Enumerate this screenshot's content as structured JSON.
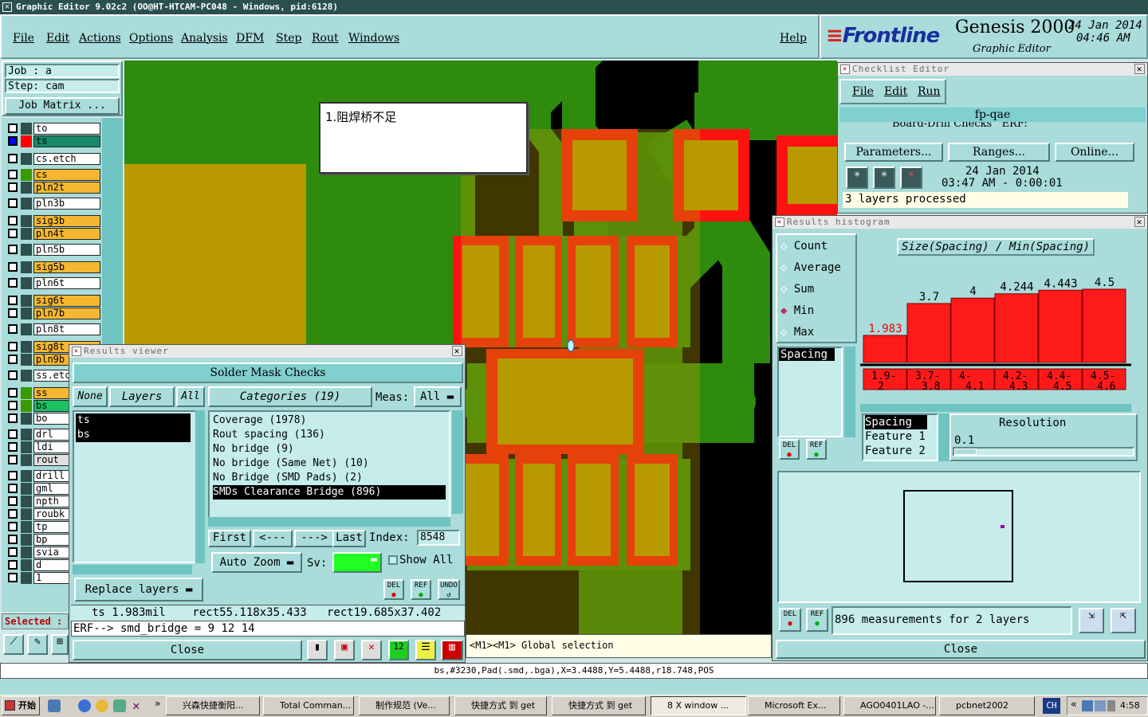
{
  "window_title": "Graphic Editor 9.02c2  (OO@HT-HTCAM-PC048 - Windows, pid:6128)",
  "menu": [
    "File",
    "Edit",
    "Actions",
    "Options",
    "Analysis",
    "DFM",
    "Step",
    "Rout",
    "Windows"
  ],
  "help": "Help",
  "brand": {
    "logo": "Frontline",
    "product": "Genesis 2000",
    "sub": "Graphic Editor",
    "date": "24 Jan 2014",
    "time": "04:46 AM"
  },
  "job": {
    "job": "Job : a",
    "step": "Step: cam",
    "matrix": "Job Matrix ..."
  },
  "layers": [
    "to",
    "ts",
    "cs.etch",
    "cs",
    "pln2t",
    "pln3b",
    "sig3b",
    "pln4t",
    "pln5b",
    "sig5b",
    "pln6t",
    "sig6t",
    "pln7b",
    "pln8t",
    "sig8t",
    "pln9b",
    "ss.etc",
    "ss",
    "bs",
    "bo",
    "drl",
    "ldi",
    "rout",
    "drill",
    "gml",
    "npth",
    "roubk",
    "tp",
    "bp",
    "svia",
    "d",
    "1"
  ],
  "selected_label": "Selected :",
  "annotation": "1.阻焊桥不足",
  "results_viewer": {
    "title": "Results viewer",
    "heading": "Solder Mask Checks",
    "none": "None",
    "layers": "Layers",
    "all": "All",
    "categories": "Categories (19)",
    "meas_label": "Meas:",
    "meas_value": "All",
    "layer_list": [
      "ts",
      "bs"
    ],
    "category_list": [
      "Coverage (1978)",
      "Rout spacing (136)",
      "No bridge (9)",
      "No bridge (Same Net) (10)",
      "No Bridge (SMD Pads) (2)",
      "SMDs Clearance Bridge (896)"
    ],
    "first": "First",
    "prev": "<---",
    "next": "--->",
    "last": "Last",
    "index_label": "Index:",
    "index_value": "8548",
    "auto_zoom": "Auto Zoom",
    "sv": "Sv:",
    "show_all": "Show All",
    "replace": "Replace layers",
    "del": "DEL",
    "ref": "REF",
    "undo": "UNDO",
    "info": "ts 1.983mil    rect55.118x35.433   rect19.685x37.402",
    "erf": "ERF--> smd_bridge = 9 12 14",
    "close": "Close"
  },
  "checklist": {
    "title": "Checklist Editor",
    "menu": [
      "File",
      "Edit",
      "Run"
    ],
    "name": "fp-qae",
    "row": "Board-Drill Checks",
    "erf": "ERF:",
    "params": "Parameters...",
    "ranges": "Ranges...",
    "online": "Online...",
    "date": "24 Jan 2014",
    "time": "03:47 AM - 0:00:01",
    "status": "3 layers processed"
  },
  "histogram": {
    "title": "Results histogram",
    "options": [
      "Count",
      "Average",
      "Sum",
      "Min",
      "Max"
    ],
    "selected_option": "Min",
    "chart_title": "Size(Spacing) / Min(Spacing)",
    "param": "Spacing",
    "res_list": [
      "Spacing",
      "Feature 1",
      "Feature 2"
    ],
    "resolution_label": "Resolution",
    "resolution_value": "0.1",
    "summary": "896 measurements for 2 layers",
    "close": "Close",
    "del": "DEL",
    "ref": "REF"
  },
  "chart_data": {
    "type": "bar",
    "title": "Size(Spacing) / Min(Spacing)",
    "categories": [
      "1.9-2",
      "3.7-3.8",
      "4-4.1",
      "4.2-4.3",
      "4.4-4.5",
      "4.5-4.6"
    ],
    "values": [
      1.983,
      3.7,
      4,
      4.244,
      4.443,
      4.5
    ],
    "value_labels": [
      "1.983",
      "3.7",
      "4",
      "4.244",
      "4.443",
      "4.5"
    ],
    "ylim": [
      0,
      4.5
    ]
  },
  "status_line": "<M1><M1> Global selection",
  "coord_line": "bs,#3230,Pad(.smd,.bga),X=3.4488,Y=5.4488,r18.748,POS",
  "taskbar": {
    "start": "开始",
    "tasks": [
      "兴森快捷衡阳...",
      "Total Comman...",
      "制作规范 (Ve...",
      "快捷方式 到 get",
      "快捷方式 到 get",
      "8 X window ...",
      "Microsoft Ex...",
      "AGO0401LAO -...",
      "pcbnet2002"
    ],
    "lang": "CH",
    "clock": "4:58"
  },
  "colors": {
    "panel": "#a9dcdb",
    "pcb_green": "#2e8b0e",
    "pad_gold": "#b89a00",
    "mask_red": "#ff1111",
    "bar_red": "#ff1a1a"
  }
}
